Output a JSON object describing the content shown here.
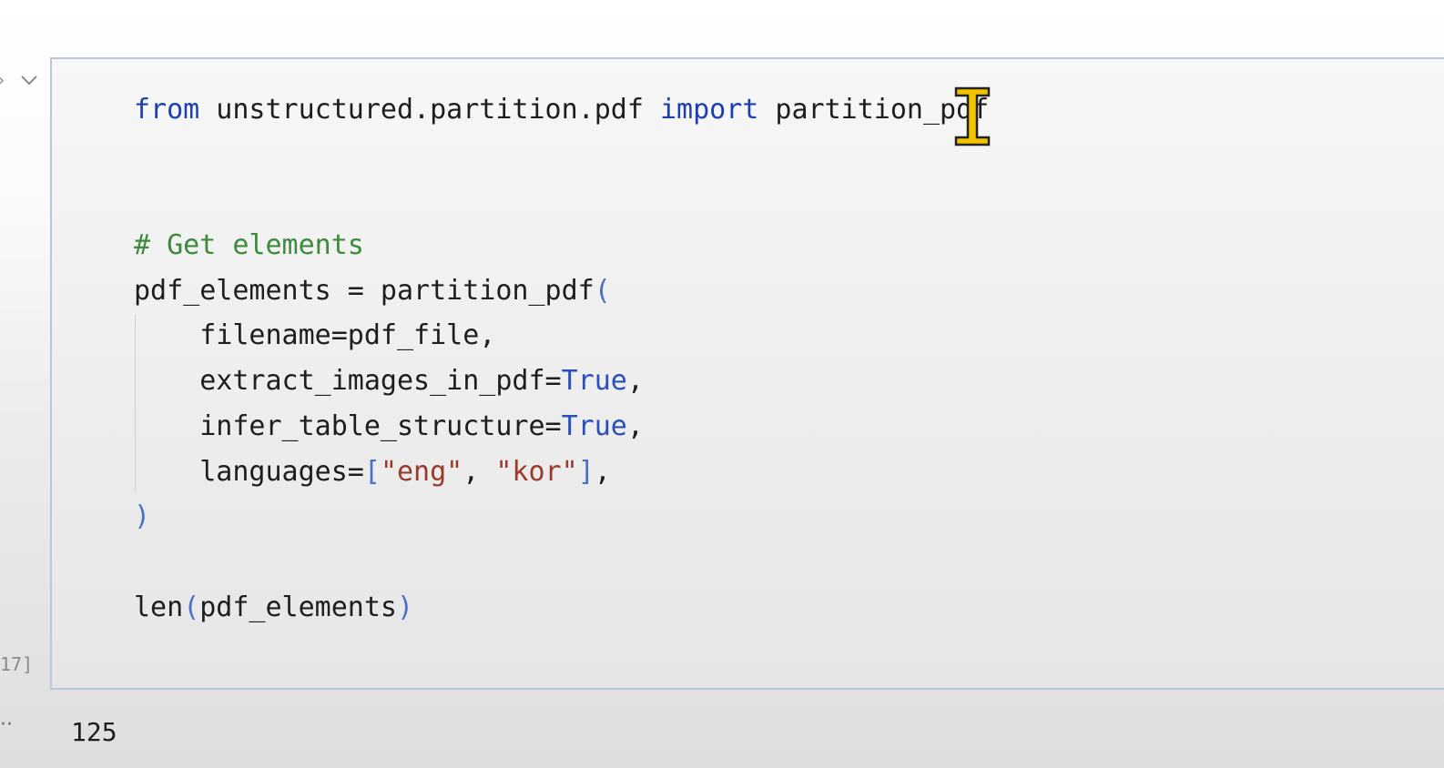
{
  "cell": {
    "gutter_glyph": "›",
    "execution_count": "17]",
    "code_lines": [
      [
        {
          "t": "from",
          "c": "kw"
        },
        {
          "t": " unstructured.partition.pdf ",
          "c": "pn"
        },
        {
          "t": "import",
          "c": "kw"
        },
        {
          "t": " partition_pdf",
          "c": "pn"
        }
      ],
      [],
      [],
      [
        {
          "t": "# Get elements",
          "c": "cm"
        }
      ],
      [
        {
          "t": "pdf_elements = partition_pdf",
          "c": "pn"
        },
        {
          "t": "(",
          "c": "br"
        }
      ],
      [
        {
          "t": "    filename=pdf_file,",
          "c": "pn"
        }
      ],
      [
        {
          "t": "    extract_images_in_pdf=",
          "c": "pn"
        },
        {
          "t": "True",
          "c": "bool"
        },
        {
          "t": ",",
          "c": "pn"
        }
      ],
      [
        {
          "t": "    infer_table_structure=",
          "c": "pn"
        },
        {
          "t": "True",
          "c": "bool"
        },
        {
          "t": ",",
          "c": "pn"
        }
      ],
      [
        {
          "t": "    languages=",
          "c": "pn"
        },
        {
          "t": "[",
          "c": "br"
        },
        {
          "t": "\"eng\"",
          "c": "str"
        },
        {
          "t": ", ",
          "c": "pn"
        },
        {
          "t": "\"kor\"",
          "c": "str"
        },
        {
          "t": "]",
          "c": "br"
        },
        {
          "t": ",",
          "c": "pn"
        }
      ],
      [
        {
          "t": ")",
          "c": "br"
        }
      ],
      [],
      [
        {
          "t": "len",
          "c": "pn"
        },
        {
          "t": "(",
          "c": "br"
        },
        {
          "t": "pdf_elements",
          "c": "pn"
        },
        {
          "t": ")",
          "c": "br"
        }
      ]
    ]
  },
  "output": {
    "gutter_glyph": "··",
    "value": "125"
  },
  "colors": {
    "keyword": "#1a3fb5",
    "comment": "#3d8a3d",
    "boolean": "#2a4fb8",
    "string": "#9a3a2a",
    "bracket": "#4a6fc8",
    "cell_border": "#b9c7dc",
    "cursor": "#e8b800"
  },
  "cursor": {
    "icon": "ibeam-cursor-icon"
  }
}
